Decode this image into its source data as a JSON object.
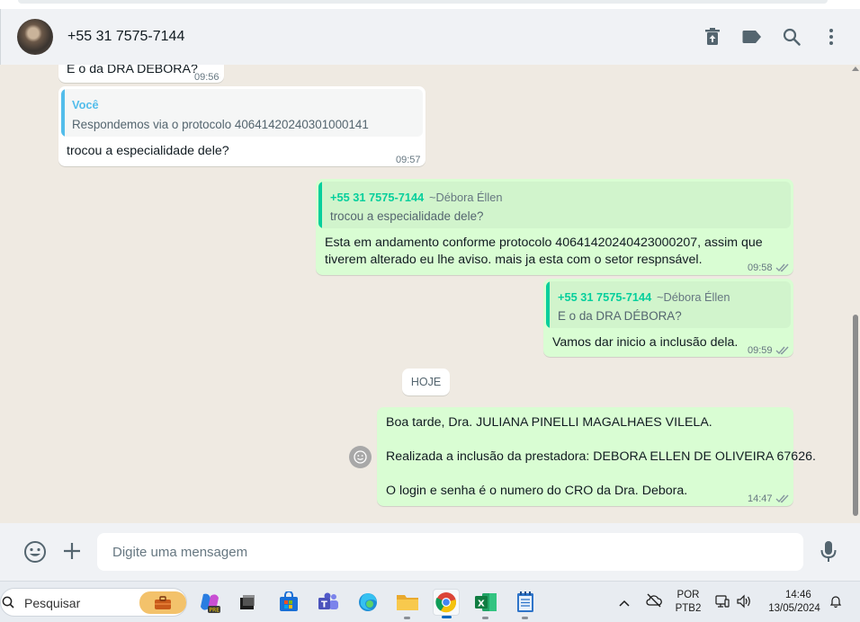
{
  "header": {
    "contact_name": "+55 31 7575-7144",
    "icons": [
      "delete-icon",
      "label-icon",
      "search-icon",
      "menu-icon"
    ]
  },
  "messages": [
    {
      "direction": "in",
      "text": "E o da DRA DÉBORA?",
      "time": "09:56"
    },
    {
      "direction": "in",
      "quote_author": "Você",
      "quote_text": "Respondemos via o protocolo 40641420240301000141",
      "text": "trocou a especialidade dele?",
      "time": "09:57"
    },
    {
      "direction": "out",
      "quote_author": "+55 31 7575-7144",
      "quote_alias": "~Débora Éllen",
      "quote_text": "trocou a especialidade dele?",
      "text_line1": "Esta em andamento conforme protocolo 40641420240423000207, assim que",
      "text_line2": "tiverem alterado eu lhe aviso. mais ja esta com o setor respnsável.",
      "time": "09:58"
    },
    {
      "direction": "out",
      "quote_author": "+55 31 7575-7144",
      "quote_alias": "~Débora Éllen",
      "quote_text": "E o da DRA DÉBORA?",
      "text": "Vamos dar inicio a inclusão dela.",
      "time": "09:59"
    },
    {
      "direction": "out",
      "line1": "Boa tarde, Dra. JULIANA PINELLI MAGALHAES VILELA.",
      "line2": "Realizada a inclusão da prestadora: DEBORA ELLEN DE OLIVEIRA 67626.",
      "line3": "O login e senha é o numero do CRO da Dra. Debora.",
      "time": "14:47"
    }
  ],
  "date_divider": "HOJE",
  "composer": {
    "placeholder": "Digite uma mensagem"
  },
  "taskbar": {
    "search_label": "Pesquisar",
    "lang_line1": "POR",
    "lang_line2": "PTB2",
    "clock_time": "14:46",
    "clock_date": "13/05/2024"
  },
  "colors": {
    "accent_green": "#25d366",
    "quote_you": "#53bdeb",
    "quote_contact": "#06cf9c",
    "out_bubble": "#d9fdd3",
    "chat_bg": "#efeae2"
  }
}
